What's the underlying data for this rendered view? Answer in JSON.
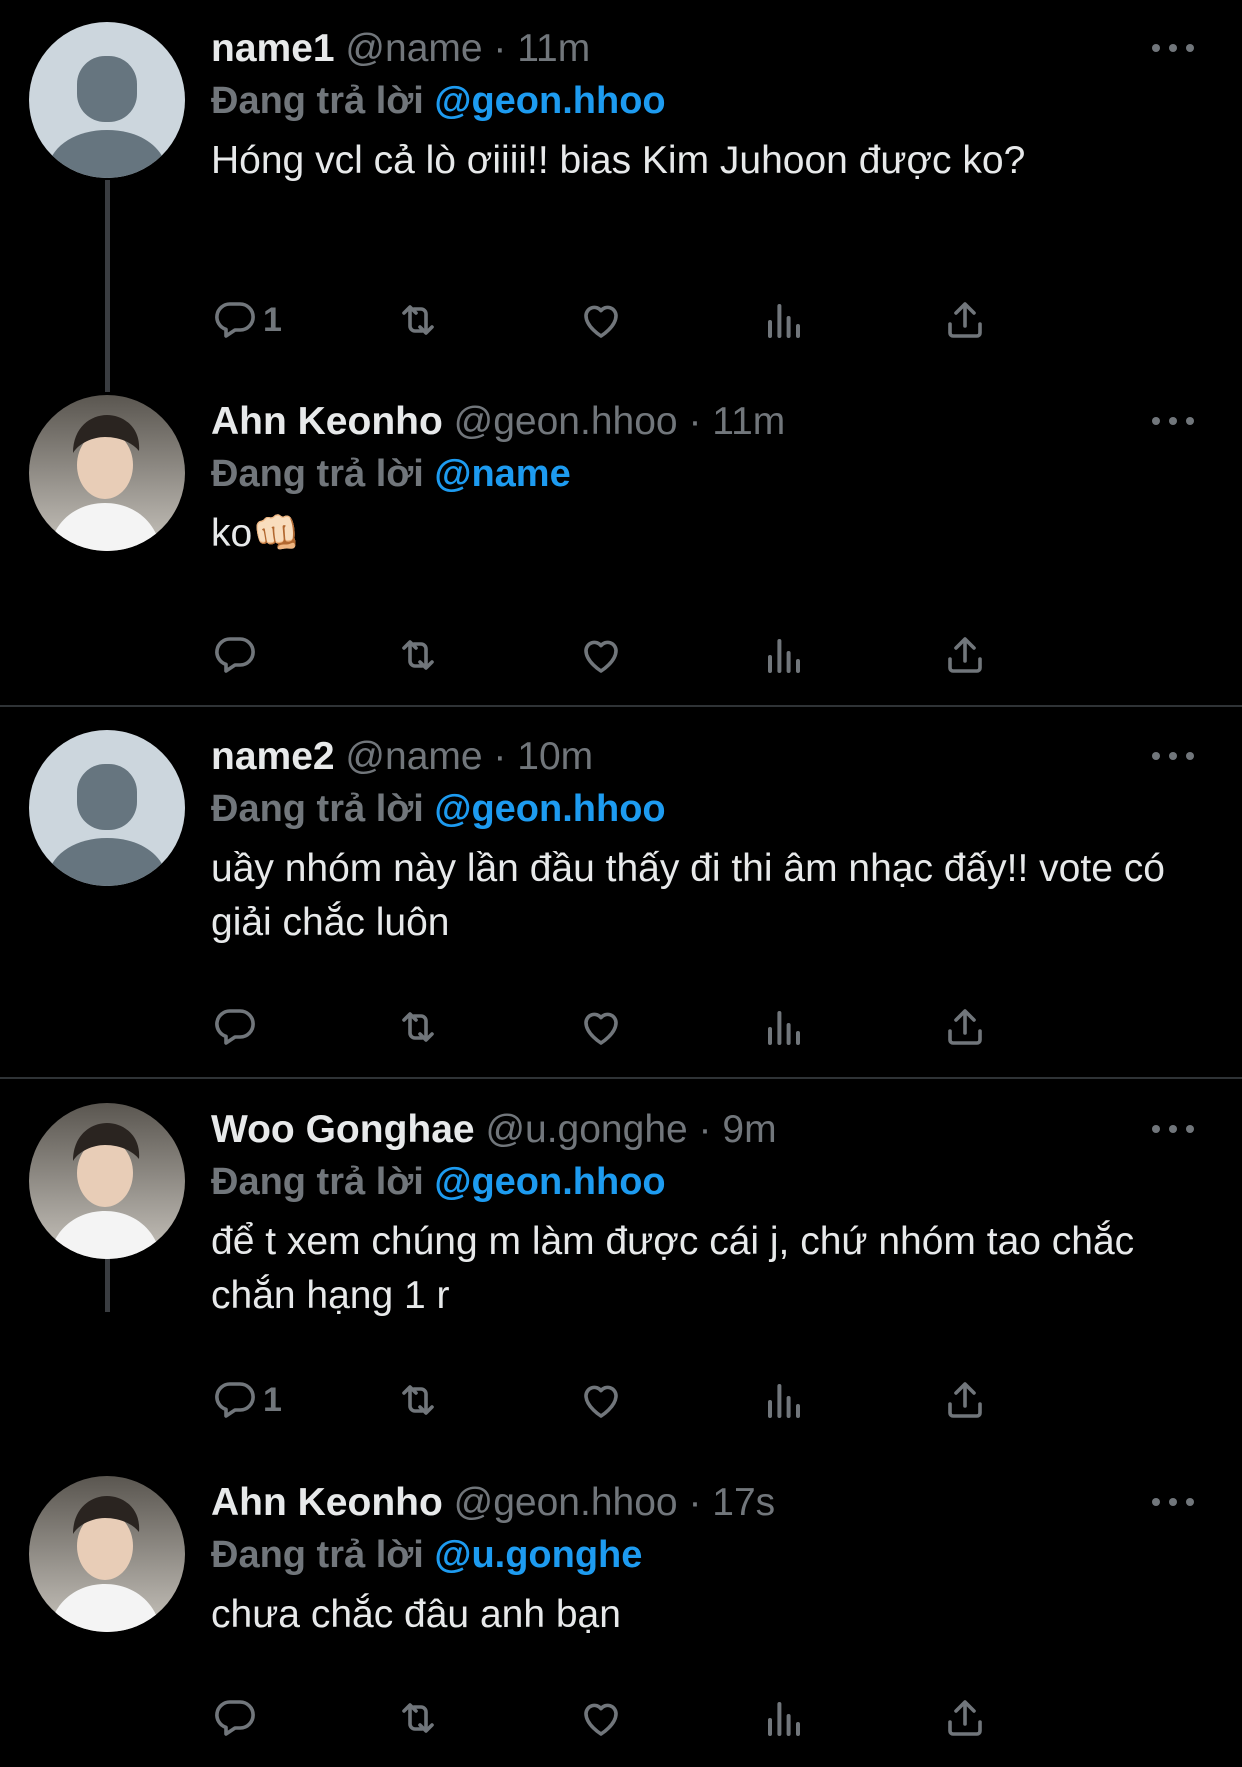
{
  "tweets": [
    {
      "name": "name1",
      "handle": "@name",
      "dot": "·",
      "time": "11m",
      "reply_prefix": "Đang trả lời",
      "reply_to": "@geon.hhoo",
      "text": "Hóng vcl cả lò ơiiii!! bias Kim Juhoon được ko?",
      "reply_count": "1",
      "avatar": "default-avatar"
    },
    {
      "name": "Ahn Keonho",
      "handle": "@geon.hhoo",
      "dot": "·",
      "time": "11m",
      "reply_prefix": "Đang trả lời",
      "reply_to": "@name",
      "text": "ko👊🏻",
      "reply_count": "",
      "avatar": "photo-avatar"
    },
    {
      "name": "name2",
      "handle": "@name",
      "dot": "·",
      "time": "10m",
      "reply_prefix": "Đang trả lời",
      "reply_to": "@geon.hhoo",
      "text": "uầy nhóm này lần đầu thấy đi thi âm nhạc đấy!! vote có giải chắc luôn",
      "reply_count": "",
      "avatar": "default-avatar"
    },
    {
      "name": "Woo Gonghae",
      "handle": "@u.gonghe",
      "dot": "·",
      "time": "9m",
      "reply_prefix": "Đang trả lời",
      "reply_to": "@geon.hhoo",
      "text": "để t xem chúng m làm được cái j, chứ nhóm tao chắc chắn hạng 1 r",
      "reply_count": "1",
      "avatar": "photo-avatar"
    },
    {
      "name": "Ahn Keonho",
      "handle": "@geon.hhoo",
      "dot": "·",
      "time": "17s",
      "reply_prefix": "Đang trả lời",
      "reply_to": "@u.gonghe",
      "text": "chưa chắc đâu anh bạn",
      "reply_count": "",
      "avatar": "photo-avatar"
    }
  ],
  "icons": {
    "reply": "reply-icon",
    "retweet": "retweet-icon",
    "like": "heart-icon",
    "views": "views-icon",
    "share": "share-icon",
    "more": "more-icon"
  },
  "colors": {
    "background": "#000000",
    "text": "#e7e9ea",
    "muted": "#71767b",
    "mention": "#1d9bf0",
    "divider": "#2f3336"
  }
}
